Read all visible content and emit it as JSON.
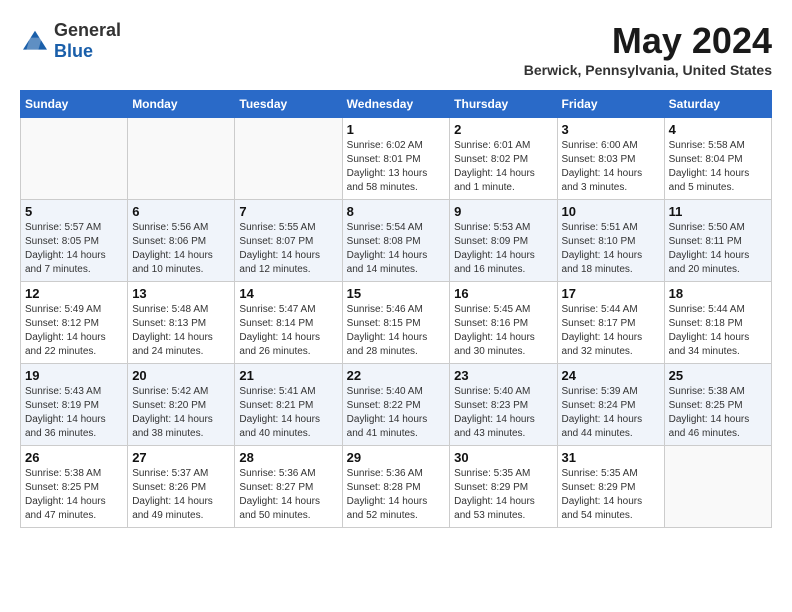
{
  "header": {
    "logo_general": "General",
    "logo_blue": "Blue",
    "month_title": "May 2024",
    "location": "Berwick, Pennsylvania, United States"
  },
  "days_of_week": [
    "Sunday",
    "Monday",
    "Tuesday",
    "Wednesday",
    "Thursday",
    "Friday",
    "Saturday"
  ],
  "weeks": [
    [
      {
        "day": "",
        "sunrise": "",
        "sunset": "",
        "daylight": ""
      },
      {
        "day": "",
        "sunrise": "",
        "sunset": "",
        "daylight": ""
      },
      {
        "day": "",
        "sunrise": "",
        "sunset": "",
        "daylight": ""
      },
      {
        "day": "1",
        "sunrise": "Sunrise: 6:02 AM",
        "sunset": "Sunset: 8:01 PM",
        "daylight": "Daylight: 13 hours and 58 minutes."
      },
      {
        "day": "2",
        "sunrise": "Sunrise: 6:01 AM",
        "sunset": "Sunset: 8:02 PM",
        "daylight": "Daylight: 14 hours and 1 minute."
      },
      {
        "day": "3",
        "sunrise": "Sunrise: 6:00 AM",
        "sunset": "Sunset: 8:03 PM",
        "daylight": "Daylight: 14 hours and 3 minutes."
      },
      {
        "day": "4",
        "sunrise": "Sunrise: 5:58 AM",
        "sunset": "Sunset: 8:04 PM",
        "daylight": "Daylight: 14 hours and 5 minutes."
      }
    ],
    [
      {
        "day": "5",
        "sunrise": "Sunrise: 5:57 AM",
        "sunset": "Sunset: 8:05 PM",
        "daylight": "Daylight: 14 hours and 7 minutes."
      },
      {
        "day": "6",
        "sunrise": "Sunrise: 5:56 AM",
        "sunset": "Sunset: 8:06 PM",
        "daylight": "Daylight: 14 hours and 10 minutes."
      },
      {
        "day": "7",
        "sunrise": "Sunrise: 5:55 AM",
        "sunset": "Sunset: 8:07 PM",
        "daylight": "Daylight: 14 hours and 12 minutes."
      },
      {
        "day": "8",
        "sunrise": "Sunrise: 5:54 AM",
        "sunset": "Sunset: 8:08 PM",
        "daylight": "Daylight: 14 hours and 14 minutes."
      },
      {
        "day": "9",
        "sunrise": "Sunrise: 5:53 AM",
        "sunset": "Sunset: 8:09 PM",
        "daylight": "Daylight: 14 hours and 16 minutes."
      },
      {
        "day": "10",
        "sunrise": "Sunrise: 5:51 AM",
        "sunset": "Sunset: 8:10 PM",
        "daylight": "Daylight: 14 hours and 18 minutes."
      },
      {
        "day": "11",
        "sunrise": "Sunrise: 5:50 AM",
        "sunset": "Sunset: 8:11 PM",
        "daylight": "Daylight: 14 hours and 20 minutes."
      }
    ],
    [
      {
        "day": "12",
        "sunrise": "Sunrise: 5:49 AM",
        "sunset": "Sunset: 8:12 PM",
        "daylight": "Daylight: 14 hours and 22 minutes."
      },
      {
        "day": "13",
        "sunrise": "Sunrise: 5:48 AM",
        "sunset": "Sunset: 8:13 PM",
        "daylight": "Daylight: 14 hours and 24 minutes."
      },
      {
        "day": "14",
        "sunrise": "Sunrise: 5:47 AM",
        "sunset": "Sunset: 8:14 PM",
        "daylight": "Daylight: 14 hours and 26 minutes."
      },
      {
        "day": "15",
        "sunrise": "Sunrise: 5:46 AM",
        "sunset": "Sunset: 8:15 PM",
        "daylight": "Daylight: 14 hours and 28 minutes."
      },
      {
        "day": "16",
        "sunrise": "Sunrise: 5:45 AM",
        "sunset": "Sunset: 8:16 PM",
        "daylight": "Daylight: 14 hours and 30 minutes."
      },
      {
        "day": "17",
        "sunrise": "Sunrise: 5:44 AM",
        "sunset": "Sunset: 8:17 PM",
        "daylight": "Daylight: 14 hours and 32 minutes."
      },
      {
        "day": "18",
        "sunrise": "Sunrise: 5:44 AM",
        "sunset": "Sunset: 8:18 PM",
        "daylight": "Daylight: 14 hours and 34 minutes."
      }
    ],
    [
      {
        "day": "19",
        "sunrise": "Sunrise: 5:43 AM",
        "sunset": "Sunset: 8:19 PM",
        "daylight": "Daylight: 14 hours and 36 minutes."
      },
      {
        "day": "20",
        "sunrise": "Sunrise: 5:42 AM",
        "sunset": "Sunset: 8:20 PM",
        "daylight": "Daylight: 14 hours and 38 minutes."
      },
      {
        "day": "21",
        "sunrise": "Sunrise: 5:41 AM",
        "sunset": "Sunset: 8:21 PM",
        "daylight": "Daylight: 14 hours and 40 minutes."
      },
      {
        "day": "22",
        "sunrise": "Sunrise: 5:40 AM",
        "sunset": "Sunset: 8:22 PM",
        "daylight": "Daylight: 14 hours and 41 minutes."
      },
      {
        "day": "23",
        "sunrise": "Sunrise: 5:40 AM",
        "sunset": "Sunset: 8:23 PM",
        "daylight": "Daylight: 14 hours and 43 minutes."
      },
      {
        "day": "24",
        "sunrise": "Sunrise: 5:39 AM",
        "sunset": "Sunset: 8:24 PM",
        "daylight": "Daylight: 14 hours and 44 minutes."
      },
      {
        "day": "25",
        "sunrise": "Sunrise: 5:38 AM",
        "sunset": "Sunset: 8:25 PM",
        "daylight": "Daylight: 14 hours and 46 minutes."
      }
    ],
    [
      {
        "day": "26",
        "sunrise": "Sunrise: 5:38 AM",
        "sunset": "Sunset: 8:25 PM",
        "daylight": "Daylight: 14 hours and 47 minutes."
      },
      {
        "day": "27",
        "sunrise": "Sunrise: 5:37 AM",
        "sunset": "Sunset: 8:26 PM",
        "daylight": "Daylight: 14 hours and 49 minutes."
      },
      {
        "day": "28",
        "sunrise": "Sunrise: 5:36 AM",
        "sunset": "Sunset: 8:27 PM",
        "daylight": "Daylight: 14 hours and 50 minutes."
      },
      {
        "day": "29",
        "sunrise": "Sunrise: 5:36 AM",
        "sunset": "Sunset: 8:28 PM",
        "daylight": "Daylight: 14 hours and 52 minutes."
      },
      {
        "day": "30",
        "sunrise": "Sunrise: 5:35 AM",
        "sunset": "Sunset: 8:29 PM",
        "daylight": "Daylight: 14 hours and 53 minutes."
      },
      {
        "day": "31",
        "sunrise": "Sunrise: 5:35 AM",
        "sunset": "Sunset: 8:29 PM",
        "daylight": "Daylight: 14 hours and 54 minutes."
      },
      {
        "day": "",
        "sunrise": "",
        "sunset": "",
        "daylight": ""
      }
    ]
  ]
}
